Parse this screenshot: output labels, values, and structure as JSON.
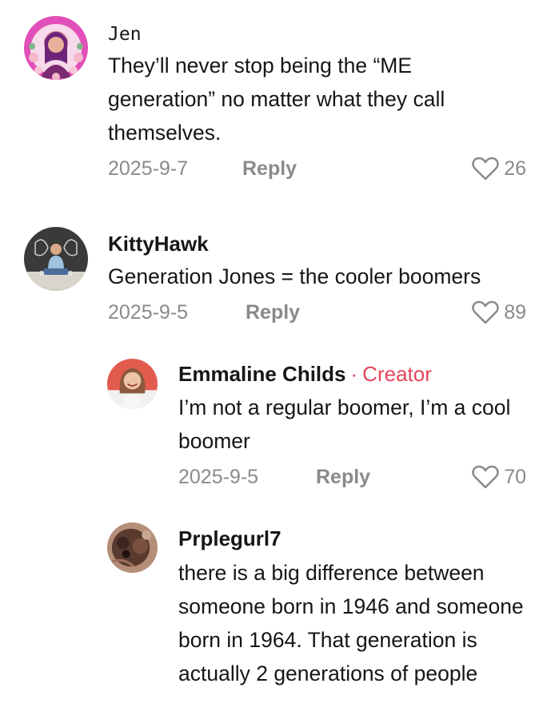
{
  "comments": [
    {
      "username": "Jen",
      "text": "They’ll never stop being the “ME generation” no matter what they call themselves.",
      "date": "2025-9-7",
      "reply_label": "Reply",
      "likes": "26",
      "avatar_icon": "avatar-pink-floral"
    },
    {
      "username": "KittyHawk",
      "text": "Generation Jones = the cooler boomers",
      "date": "2025-9-5",
      "reply_label": "Reply",
      "likes": "89",
      "avatar_icon": "avatar-person-sitting"
    }
  ],
  "replies": [
    {
      "username": "Emmaline Childs",
      "badge": "Creator",
      "text": "I’m not a regular boomer, I’m a cool boomer",
      "date": "2025-9-5",
      "reply_label": "Reply",
      "likes": "70",
      "avatar_icon": "avatar-woman-smiling"
    },
    {
      "username": "Prplegurl7",
      "text": "there is a big difference between someone born in 1946 and someone born in 1964. That generation is actually 2 generations of people",
      "avatar_icon": "avatar-dog-closeup"
    }
  ],
  "colors": {
    "creator_badge": "#e5455c",
    "meta_text": "#8a8a8a",
    "primary_text": "#161616"
  }
}
